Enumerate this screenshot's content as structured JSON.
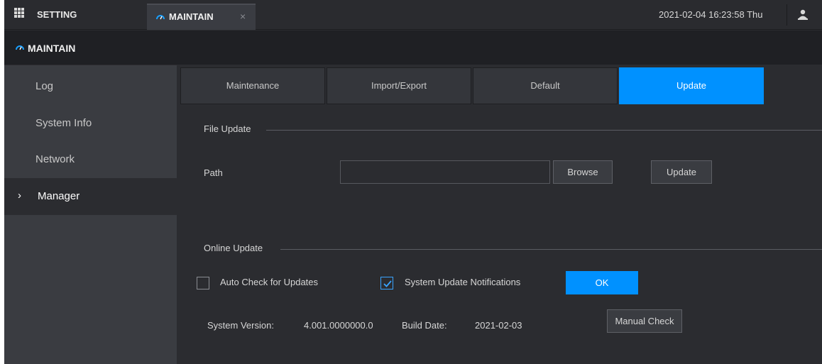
{
  "topbar": {
    "setting_label": "SETTING",
    "tab_label": "MAINTAIN",
    "tab_close": "×",
    "datetime": "2021-02-04 16:23:58 Thu"
  },
  "section": {
    "title": "MAINTAIN"
  },
  "sidebar": {
    "items": [
      {
        "label": "Log"
      },
      {
        "label": "System Info"
      },
      {
        "label": "Network"
      },
      {
        "label": "Manager",
        "active": true,
        "chevron": "›"
      }
    ]
  },
  "tabs": [
    {
      "label": "Maintenance"
    },
    {
      "label": "Import/Export"
    },
    {
      "label": "Default"
    },
    {
      "label": "Update",
      "active": true
    }
  ],
  "file_update": {
    "title": "File Update",
    "path_label": "Path",
    "path_value": "",
    "browse_label": "Browse",
    "update_label": "Update"
  },
  "online_update": {
    "title": "Online Update",
    "auto_check_label": "Auto Check for Updates",
    "auto_check_checked": false,
    "notifications_label": "System Update Notifications",
    "notifications_checked": true,
    "ok_label": "OK",
    "system_version_label": "System Version:",
    "system_version_value": "4.001.0000000.0",
    "build_date_label": "Build Date:",
    "build_date_value": "2021-02-03",
    "manual_check_label": "Manual Check"
  },
  "colors": {
    "accent": "#0091ff",
    "background": "#2b2c30",
    "sidebar": "#3a3c41",
    "header": "#1f2024"
  }
}
